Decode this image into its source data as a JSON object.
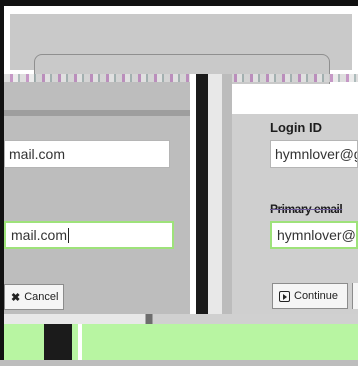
{
  "right_form": {
    "login_label": "Login ID",
    "login_value": "hymnlover@g",
    "confirm_label_partial": "Primary email",
    "confirm_value": "hymnlover@g",
    "continue_button": "Continue"
  },
  "left_form": {
    "email_value": "mail.com",
    "email_confirm_value": "mail.com",
    "cancel_button": "Cancel"
  },
  "colors": {
    "active_field_border": "#9ee27a",
    "green_bar": "#b8f5a2",
    "panel_gray": "#bdbdbd"
  },
  "icons": [
    "close-icon",
    "play-icon"
  ]
}
